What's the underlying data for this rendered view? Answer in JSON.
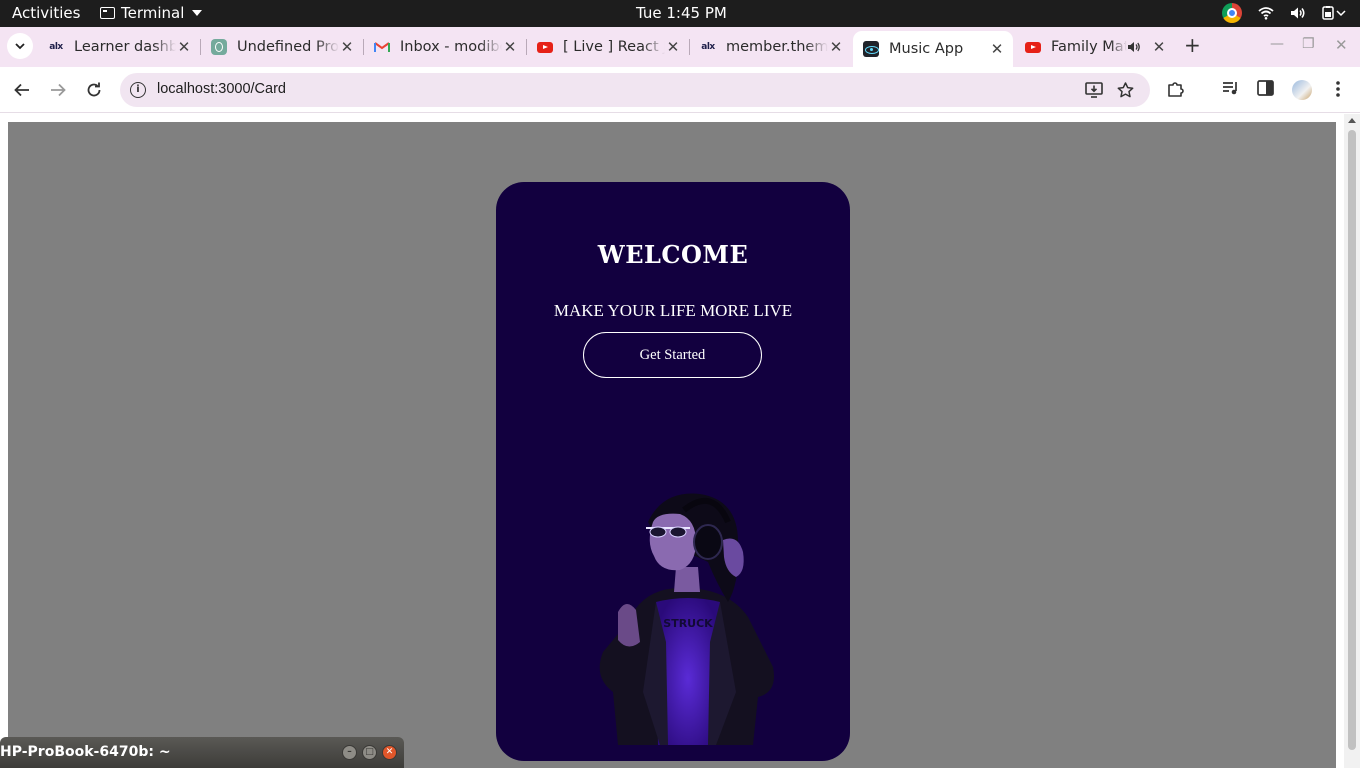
{
  "topbar": {
    "activities": "Activities",
    "app_menu": "Terminal",
    "clock": "Tue  1:45 PM"
  },
  "tabs": [
    {
      "title": "Learner dashboard",
      "favicon": "alx-icon",
      "active": false
    },
    {
      "title": "Undefined Props",
      "favicon": "chatgpt-icon",
      "active": false
    },
    {
      "title": "Inbox - modibo",
      "favicon": "gmail-icon",
      "active": false
    },
    {
      "title": "[ Live ] React JS",
      "favicon": "youtube-icon",
      "active": false
    },
    {
      "title": "member.theme",
      "favicon": "alx-icon",
      "active": false
    },
    {
      "title": "Music App",
      "favicon": "react-icon",
      "active": true
    },
    {
      "title": "Family Matters",
      "favicon": "youtube-icon",
      "active": false,
      "audio": true
    }
  ],
  "address_bar": {
    "url": "localhost:3000/Card"
  },
  "card": {
    "heading": "WELCOME",
    "tagline": "MAKE YOUR LIFE MORE LIVE",
    "button_label": "Get Started",
    "image_alt": "woman-with-headphones",
    "background": "#12003f"
  },
  "terminal_window": {
    "title": "HP-ProBook-6470b: ~"
  },
  "colors": {
    "page_background": "#808080",
    "tab_strip": "#f4e4f3",
    "topbar": "#1d1d1d"
  }
}
